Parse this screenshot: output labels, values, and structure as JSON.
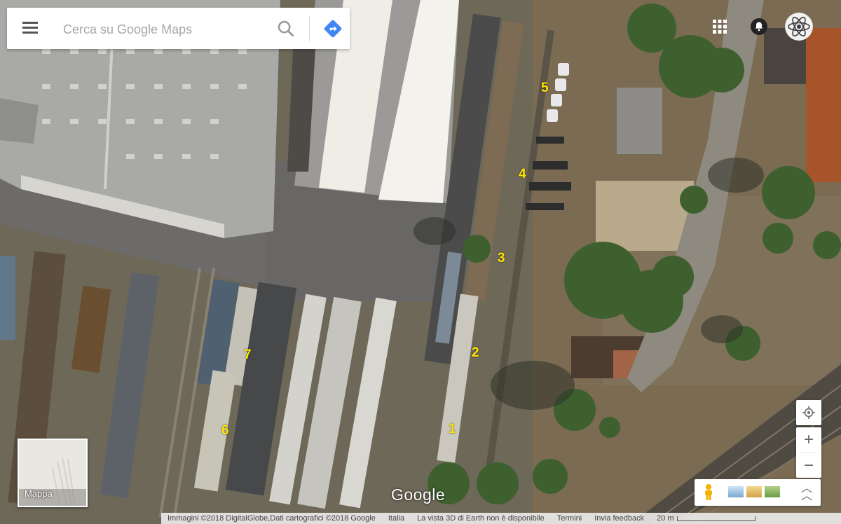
{
  "search": {
    "placeholder": "Cerca su Google Maps"
  },
  "map_labels": [
    "1",
    "2",
    "3",
    "4",
    "5",
    "6",
    "7"
  ],
  "minimap": {
    "label": "Mappa"
  },
  "logo": {
    "text": "Google"
  },
  "footer": {
    "imagery": "Immagini ©2018 DigitalGlobe,Dati cartografici ©2018 Google",
    "country": "Italia",
    "notice": "La vista 3D di Earth non è disponibile",
    "terms": "Termini",
    "feedback": "Invia feedback",
    "scale": "20 m"
  },
  "controls": {
    "zoom_in": "+",
    "zoom_out": "−"
  },
  "icons": {
    "menu": "menu-icon",
    "search": "search-icon",
    "directions": "directions-icon",
    "apps": "apps-grid-icon",
    "notifications": "bell-icon",
    "account": "avatar",
    "locate": "my-location-icon",
    "streetview": "pegman-icon",
    "layers_expand": "chevron-up-icon"
  },
  "colors": {
    "label_yellow": "#ffe600",
    "directions_blue": "#4285f4"
  }
}
